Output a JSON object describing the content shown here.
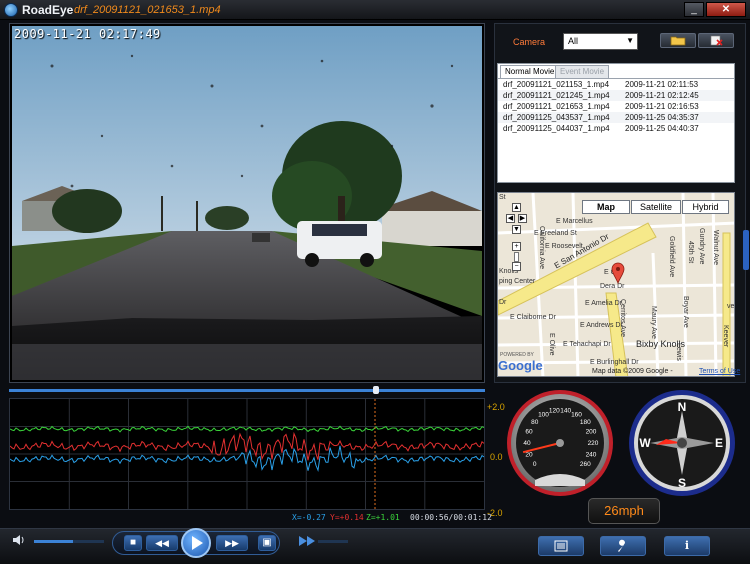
{
  "window": {
    "app_name": "RoadEye",
    "file_name": "drf_20091121_021653_1.mp4",
    "minimize_glyph": "_",
    "close_glyph": "✕"
  },
  "video": {
    "timestamp": "2009-11-21 02:17:49"
  },
  "playback": {
    "position_fraction": 0.77
  },
  "graph": {
    "axis_top": "+2.0",
    "axis_mid": "0.0",
    "axis_bottom": "-2.0",
    "x_readout": "X=-0.27",
    "y_readout": "Y=+0.14",
    "z_readout": "Z=+1.01",
    "time_readout": "00:00:56/00:01:12",
    "colors": {
      "x": "#2aa0e8",
      "y": "#e23030",
      "z": "#3ad43a",
      "marker": "#e07020"
    }
  },
  "camera": {
    "label": "Camera",
    "selected": "All"
  },
  "tabs": {
    "normal": "Normal Movie",
    "event": "Event Movie"
  },
  "files": [
    {
      "name": "drf_20091121_021153_1.mp4",
      "date": "2009-11-21 02:11:53"
    },
    {
      "name": "drf_20091121_021245_1.mp4",
      "date": "2009-11-21 02:12:45"
    },
    {
      "name": "drf_20091121_021653_1.mp4",
      "date": "2009-11-21 02:16:53"
    },
    {
      "name": "drf_20091125_043537_1.mp4",
      "date": "2009-11-25 04:35:37"
    },
    {
      "name": "drf_20091125_044037_1.mp4",
      "date": "2009-11-25 04:40:37"
    }
  ],
  "map": {
    "map_label": "Map",
    "satellite_label": "Satellite",
    "hybrid_label": "Hybrid",
    "google": "Google",
    "powered_by": "POWERED BY",
    "credit": "Map data ©2009 Google -",
    "terms": "Terms of Use",
    "streets": {
      "san_antonio": "E San Antonio Dr",
      "marcellus": "E Marcellus",
      "freeland": "E Freeland St",
      "roosevelt": "E Roosevelt",
      "claiborne": "E Claiborne Dr",
      "amelia": "E Amelia Dr",
      "andrews": "E Andrews Dr",
      "tehachapi": "E Tehachapi Dr",
      "burlinghall": "E Burlinghall Dr",
      "dera": "Dera Dr",
      "cl": "E Cl",
      "california": "California Ave",
      "cerritos": "Cerritos Ave",
      "maury": "Maury Ave",
      "boyar": "Boyar Ave",
      "goldfield": "Goldfield Ave",
      "gundry": "Gundry Ave",
      "walnut": "Walnut Ave",
      "olive": "E Olive",
      "street_45": "45th St",
      "lewis": "Lewis",
      "keever": "Keever",
      "knolls": "Knolls",
      "center": "ping Center",
      "bixby": "Bixby Knolls",
      "st": "St",
      "dr": "Dr",
      "ve": "ve"
    }
  },
  "speedometer": {
    "ticks": [
      "0",
      "20",
      "40",
      "60",
      "80",
      "100",
      "120",
      "140",
      "160",
      "180",
      "200",
      "220",
      "240",
      "260"
    ],
    "speed_label": "26mph",
    "speed_value": 26
  },
  "compass": {
    "n": "N",
    "s": "S",
    "e": "E",
    "w": "W"
  },
  "controls": {
    "stop": "■",
    "rewind": "◀◀",
    "forward": "▶▶",
    "snapshot": "▣",
    "volume_fraction": 0.55
  }
}
